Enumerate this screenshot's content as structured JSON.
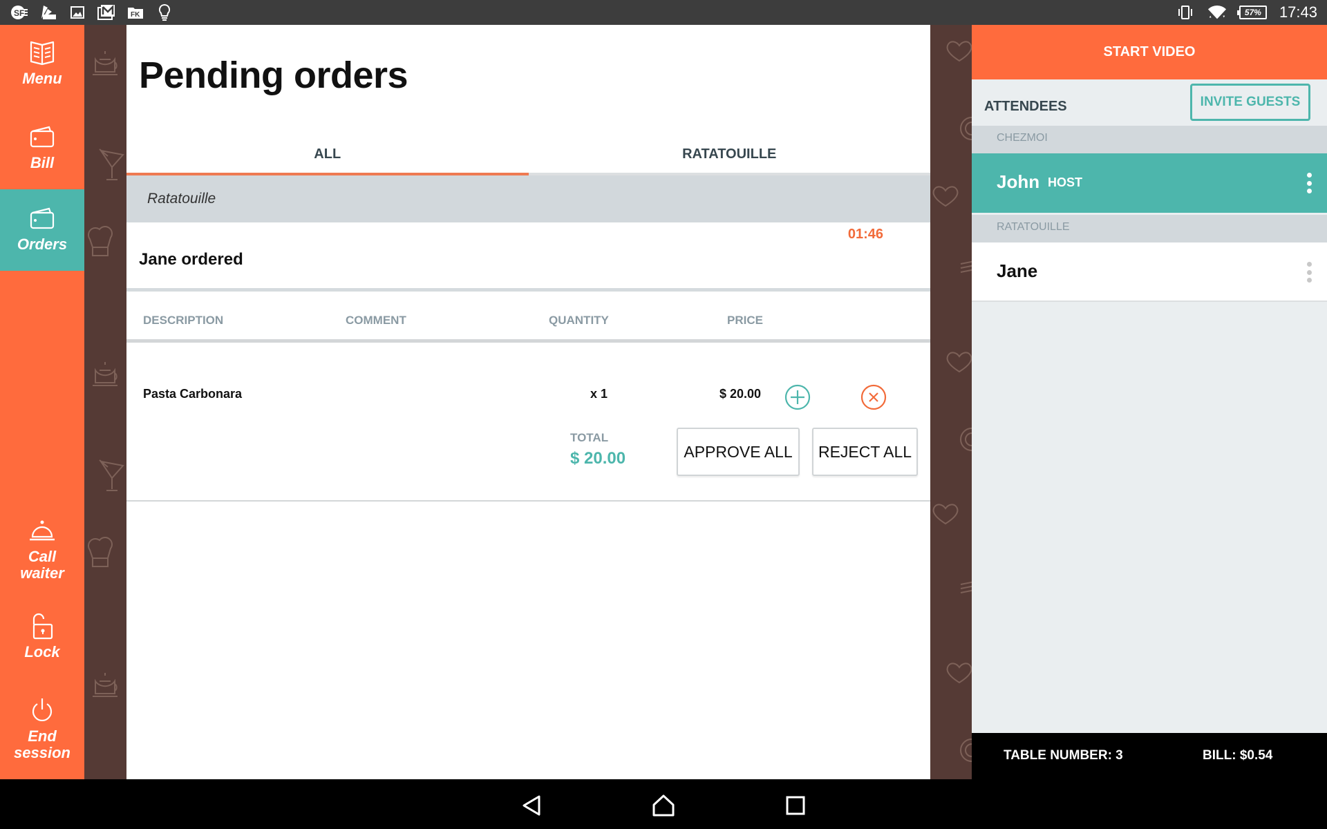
{
  "status_bar": {
    "left_icons": [
      "sf-app-icon",
      "swatch-icon",
      "image-icon",
      "gmail-icon",
      "fk-folder-icon",
      "lightbulb-icon"
    ],
    "right_icons": [
      "vibrate-icon",
      "wifi-icon",
      "battery-icon"
    ],
    "battery_percent": "57%",
    "time": "17:43"
  },
  "sidebar": {
    "items": [
      {
        "label": "Menu",
        "icon": "menu-book-icon",
        "active": false
      },
      {
        "label": "Bill",
        "icon": "wallet-icon",
        "active": false
      },
      {
        "label": "Orders",
        "icon": "wallet-icon",
        "active": true
      },
      {
        "label": "Call\nwaiter",
        "icon": "service-bell-icon",
        "active": false
      },
      {
        "label": "Lock",
        "icon": "unlock-icon",
        "active": false
      },
      {
        "label": "End\nsession",
        "icon": "power-icon",
        "active": false
      }
    ]
  },
  "main": {
    "title": "Pending orders",
    "tabs": [
      {
        "label": "ALL",
        "active": true
      },
      {
        "label": "RATATOUILLE",
        "active": false
      }
    ],
    "group": "Ratatouille",
    "order": {
      "timer": "01:46",
      "ordered_by": "Jane ordered",
      "columns": [
        "DESCRIPTION",
        "COMMENT",
        "QUANTITY",
        "PRICE"
      ],
      "items": [
        {
          "description": "Pasta Carbonara",
          "comment": "",
          "quantity": "x 1",
          "price": "$ 20.00"
        }
      ],
      "total_label": "TOTAL",
      "total_value": "$ 20.00",
      "approve_label": "APPROVE ALL",
      "reject_label": "REJECT ALL"
    }
  },
  "right_panel": {
    "start_video": "START VIDEO",
    "attendees_title": "ATTENDEES",
    "invite_label": "INVITE GUESTS",
    "sections": [
      {
        "name": "CHEZMOI",
        "attendees": [
          {
            "name": "John",
            "badge": "HOST"
          }
        ]
      },
      {
        "name": "RATATOUILLE",
        "attendees": [
          {
            "name": "Jane",
            "badge": ""
          }
        ]
      }
    ],
    "table_number": "TABLE NUMBER: 3",
    "bill": "BILL: $0.54"
  },
  "colors": {
    "accent_orange": "#ff6b3d",
    "teal": "#4db6ac",
    "brown_pattern": "#553a35",
    "timer_orange": "#f26b3a"
  }
}
